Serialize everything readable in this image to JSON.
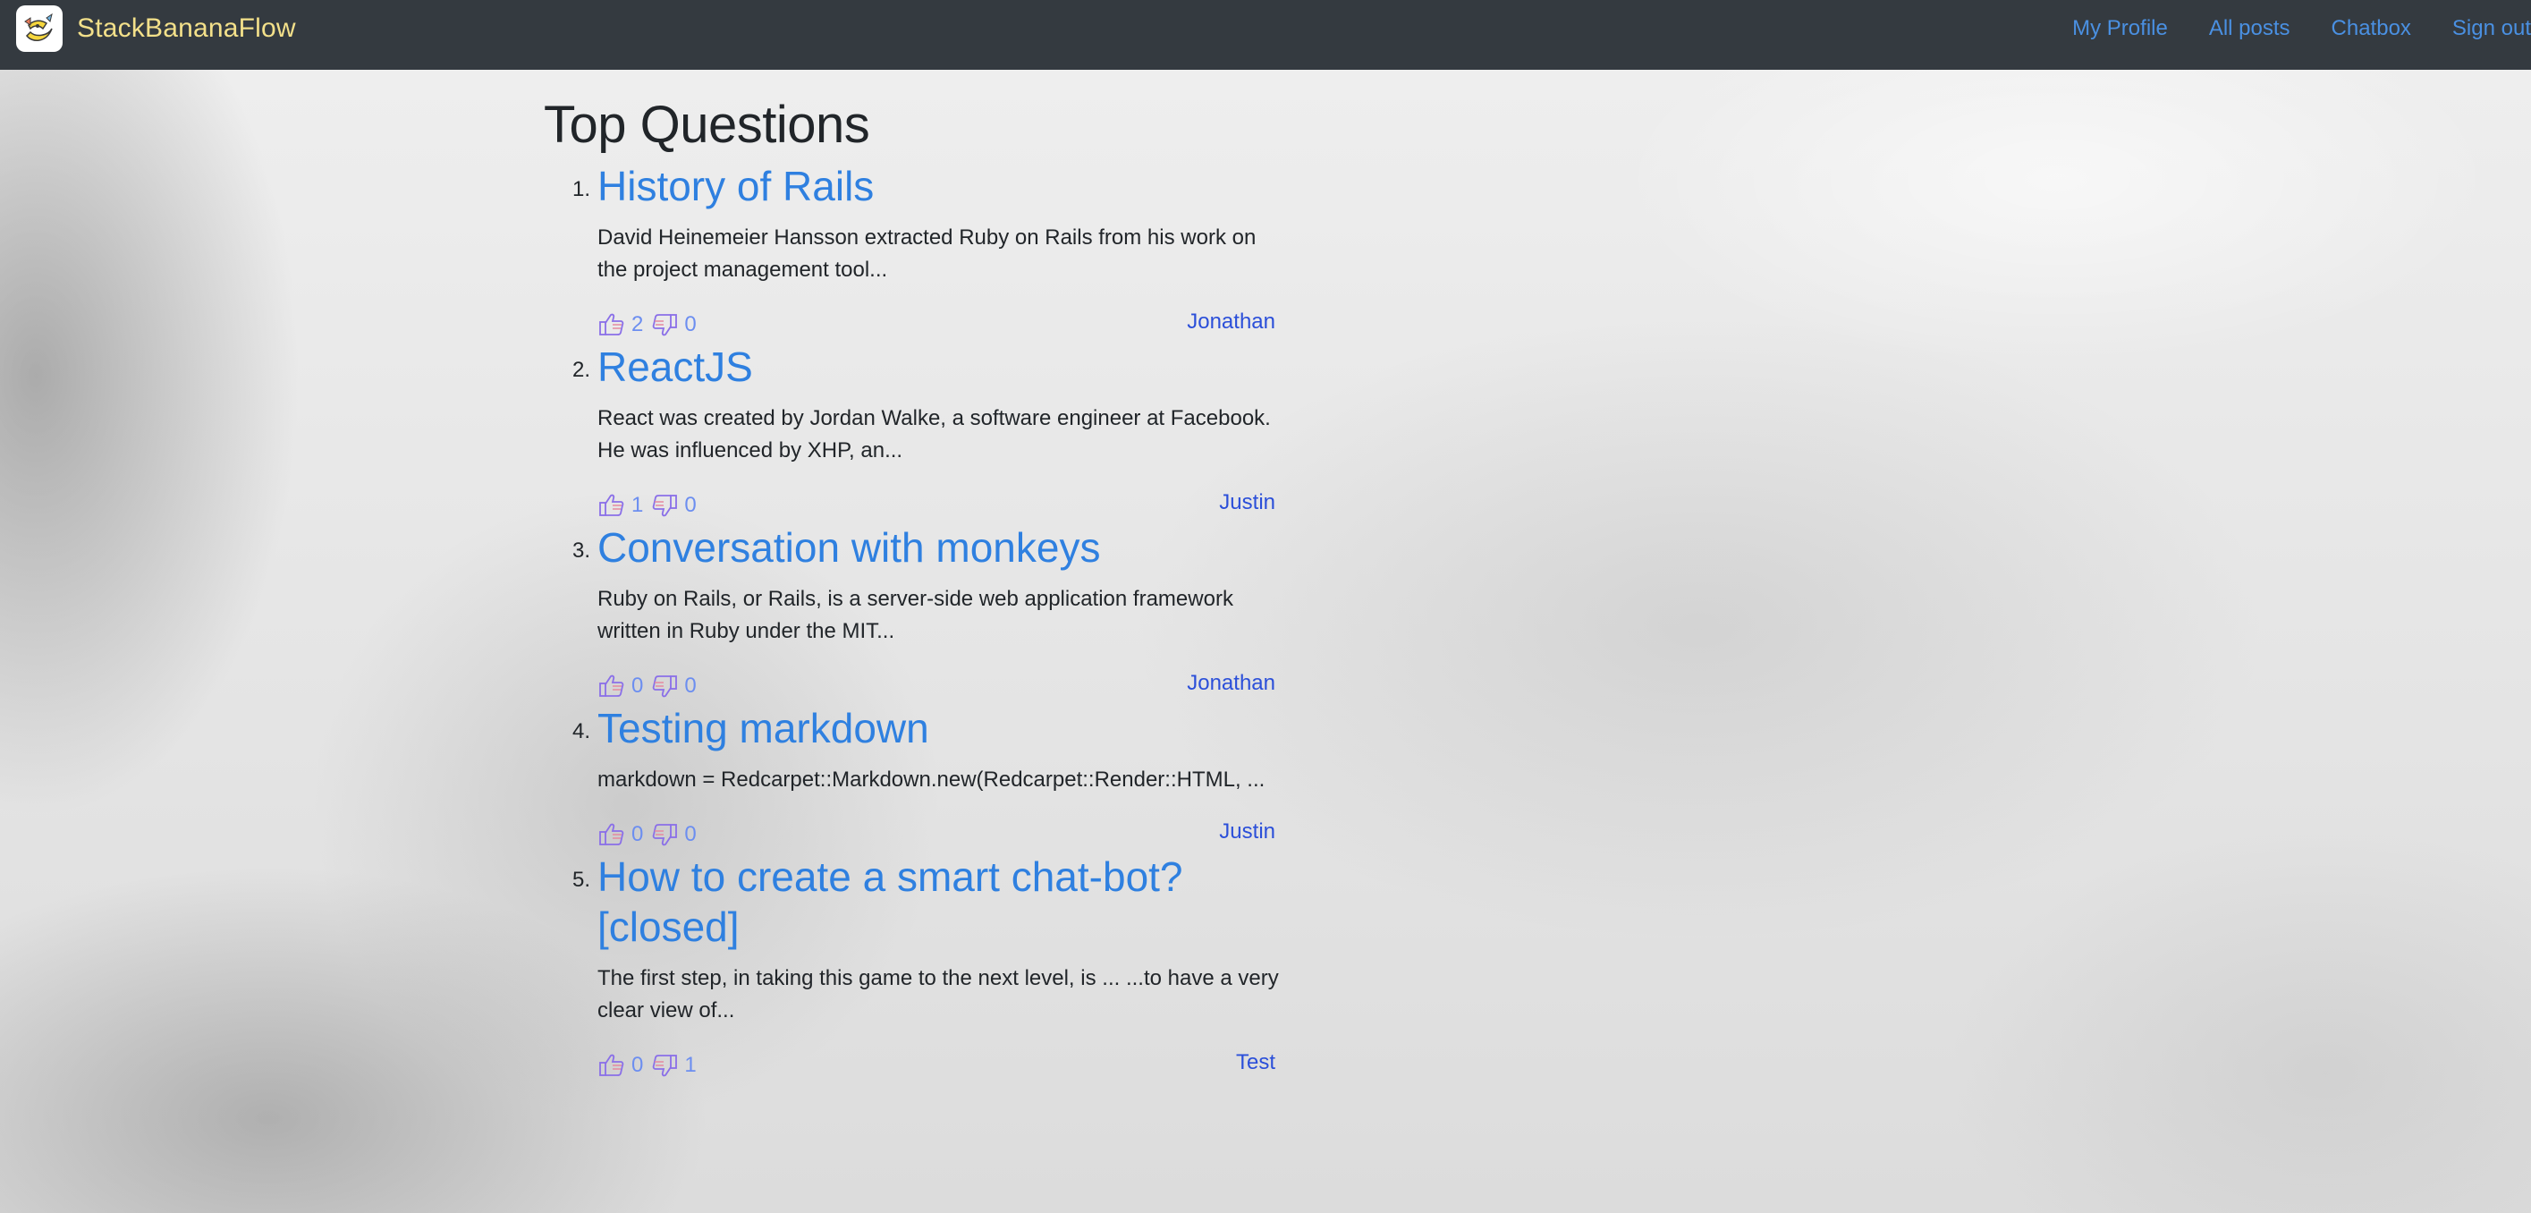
{
  "navbar": {
    "brand_name": "StackBananaFlow",
    "brand_logo_icon": "banana-mascot-icon",
    "links": [
      {
        "label": "My Profile"
      },
      {
        "label": "All posts"
      },
      {
        "label": "Chatbox"
      },
      {
        "label": "Sign out"
      }
    ]
  },
  "main": {
    "title": "Top Questions",
    "questions": [
      {
        "number": "1.",
        "title": "History of Rails",
        "excerpt": "David Heinemeier Hansson extracted Ruby on Rails from his work on the project management tool...",
        "upvotes": "2",
        "downvotes": "0",
        "author": "Jonathan"
      },
      {
        "number": "2.",
        "title": "ReactJS",
        "excerpt": "React was created by Jordan Walke, a software engineer at Facebook. He was influenced by XHP, an...",
        "upvotes": "1",
        "downvotes": "0",
        "author": "Justin"
      },
      {
        "number": "3.",
        "title": "Conversation with monkeys",
        "excerpt": "Ruby on Rails, or Rails, is a server-side web application framework written in Ruby under the MIT...",
        "upvotes": "0",
        "downvotes": "0",
        "author": "Jonathan"
      },
      {
        "number": "4.",
        "title": "Testing markdown",
        "excerpt": "markdown = Redcarpet::Markdown.new(Redcarpet::Render::HTML, ...",
        "upvotes": "0",
        "downvotes": "0",
        "author": "Justin"
      },
      {
        "number": "5.",
        "title": "How to create a smart chat-bot? [closed]",
        "excerpt": "The first step, in taking this game to the next level, is ... ...to have a very clear view of...",
        "upvotes": "0",
        "downvotes": "1",
        "author": "Test"
      }
    ]
  },
  "colors": {
    "navbar_bg": "#343a40",
    "brand_text": "#f3e08a",
    "link_blue": "#2f80e0",
    "author_blue": "#2b4fd9",
    "vote_icon_purple": "#8a6fe8"
  }
}
